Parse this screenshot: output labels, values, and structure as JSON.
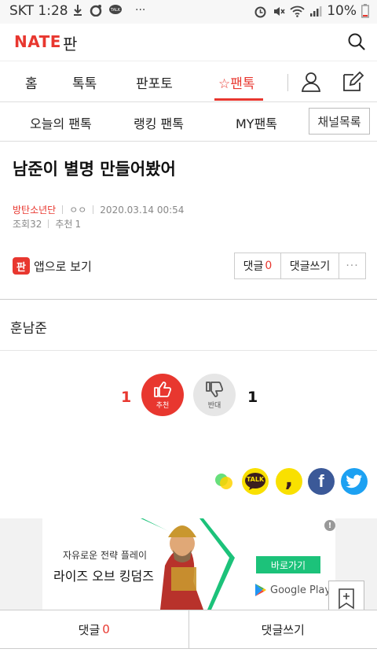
{
  "status_bar": {
    "carrier_time": "SKT 1:28",
    "more": "···",
    "battery_percent": "10%"
  },
  "header": {
    "logo_text": "NATE",
    "logo_sub": "판"
  },
  "main_nav": {
    "tabs": [
      {
        "label": "홈"
      },
      {
        "label": "톡톡"
      },
      {
        "label": "판포토"
      },
      {
        "label": "팬톡",
        "active": true
      }
    ],
    "star": "☆"
  },
  "sub_nav": {
    "tabs": [
      {
        "label": "오늘의 팬톡"
      },
      {
        "label": "랭킹 팬톡"
      },
      {
        "label": "MY팬톡"
      }
    ],
    "channel_button": "채널목록"
  },
  "post": {
    "title": "남준이 별명 만들어봤어",
    "author": "방탄소년단",
    "anon": "ㅇㅇ",
    "datetime": "2020.03.14 00:54",
    "views_label": "조회",
    "views": "32",
    "recommend_label": "추천",
    "recommend": "1",
    "body": "훈남준"
  },
  "actions": {
    "app_view_icon": "판",
    "app_view_label": "앱으로 보기",
    "comment_label": "댓글",
    "comment_count": "0",
    "write_comment": "댓글쓰기",
    "more": "···"
  },
  "vote": {
    "up_count": "1",
    "up_label": "추천",
    "down_label": "반대",
    "down_count": "1"
  },
  "share": {
    "items": [
      "band-icon",
      "kakaotalk-icon",
      "kakaostory-icon",
      "facebook-icon",
      "twitter-icon"
    ],
    "kakao_talk_text": "TALK",
    "story_text": ",",
    "facebook_text": "f"
  },
  "ad": {
    "subtitle": "자유로운 전략 플레이",
    "title": "라이즈 오브 킹덤즈",
    "cta": "바로가기",
    "store": "Google Play",
    "info": "!"
  },
  "bottom_bar": {
    "comment_label": "댓글",
    "comment_count": "0",
    "write_comment": "댓글쓰기"
  },
  "colors": {
    "accent": "#e8372f",
    "ad_green": "#1cc27a"
  }
}
